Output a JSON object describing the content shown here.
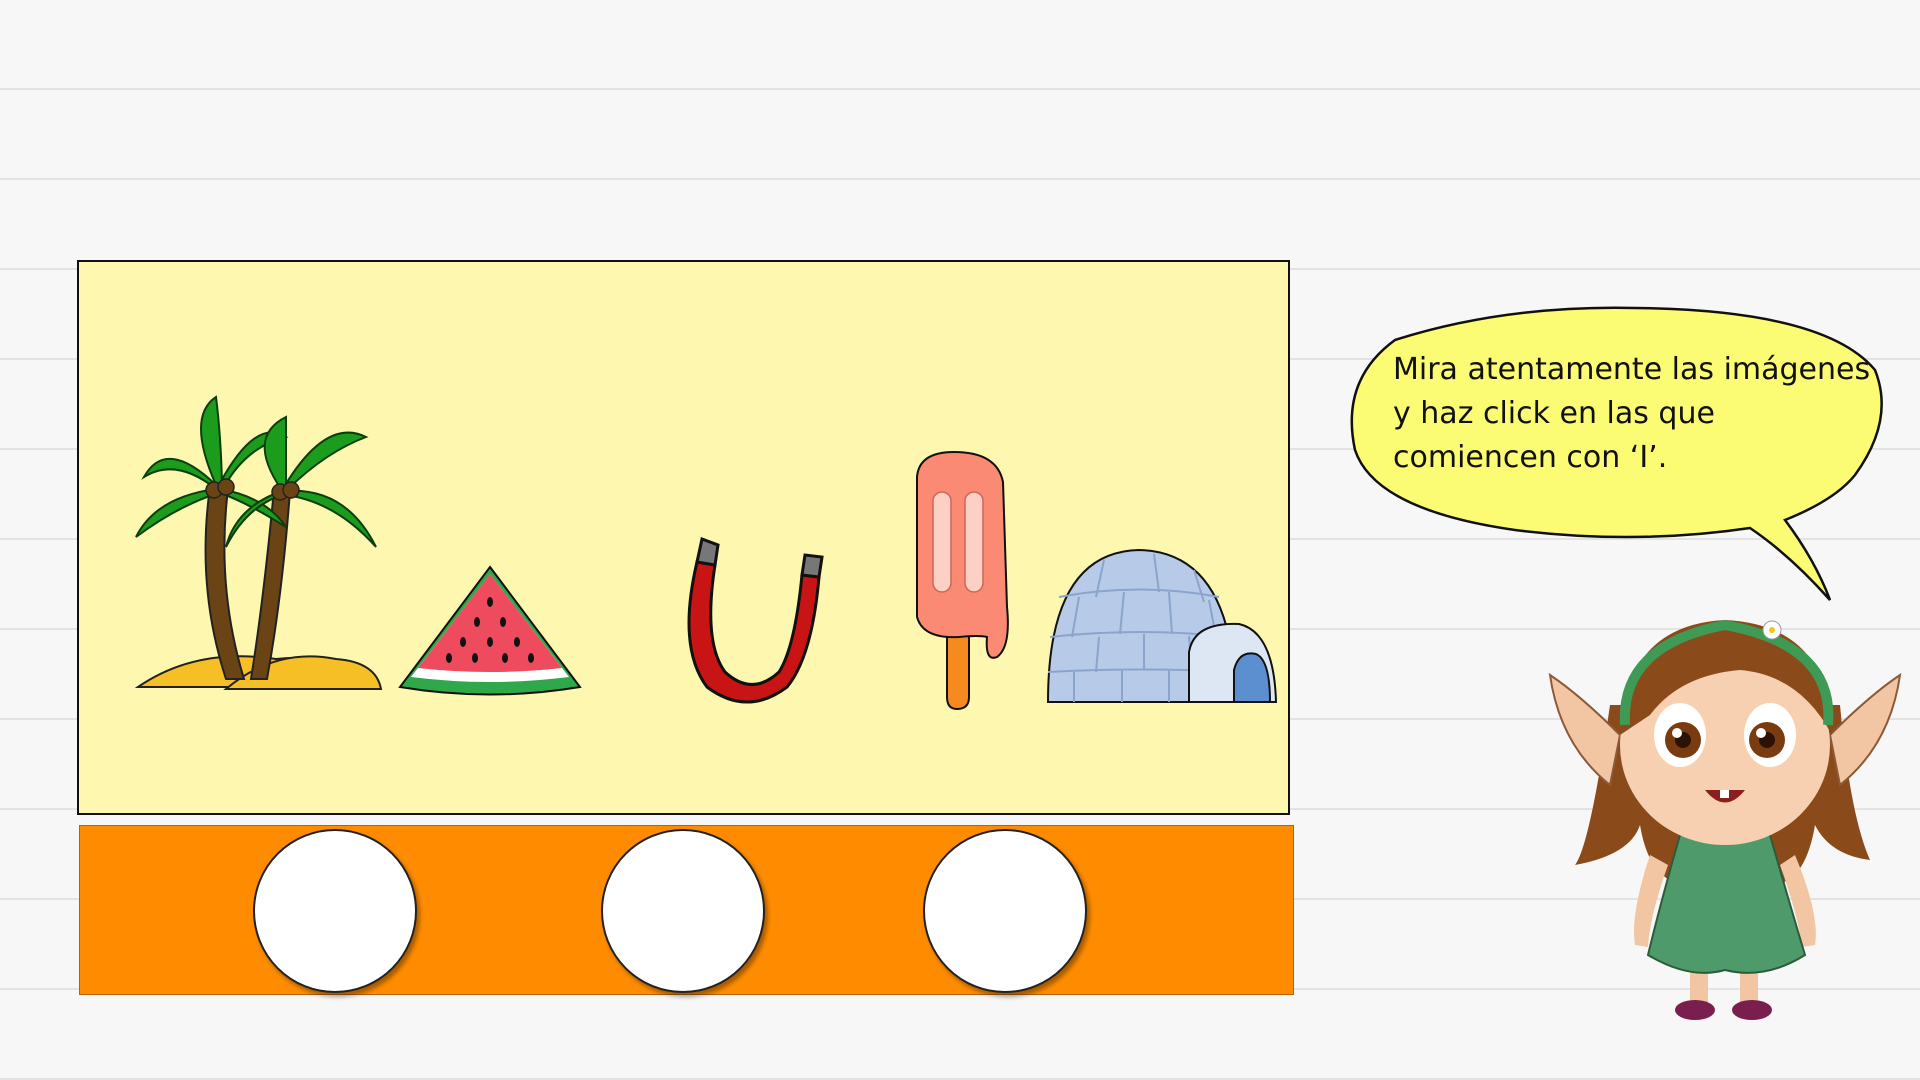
{
  "instruction": {
    "line1": "Mira atentamente las imágenes",
    "line2": "y haz click en las que",
    "line3": "comiencen con ‘I’."
  },
  "pictures": [
    {
      "id": "palm-trees",
      "icon": "palm-trees-island-icon"
    },
    {
      "id": "watermelon",
      "icon": "watermelon-slice-icon"
    },
    {
      "id": "magnet",
      "icon": "horseshoe-magnet-icon"
    },
    {
      "id": "popsicle",
      "icon": "ice-pop-icon"
    },
    {
      "id": "igloo",
      "icon": "igloo-icon"
    }
  ],
  "answer_slots": [
    {
      "id": "slot-1",
      "content": ""
    },
    {
      "id": "slot-2",
      "content": ""
    },
    {
      "id": "slot-3",
      "content": ""
    }
  ],
  "colors": {
    "panel_background": "#fdf7b0",
    "answer_bar": "#ff8c00",
    "bubble_fill": "#fbfb74",
    "dress": "#4f9a6a",
    "hair": "#8b4a1a"
  }
}
